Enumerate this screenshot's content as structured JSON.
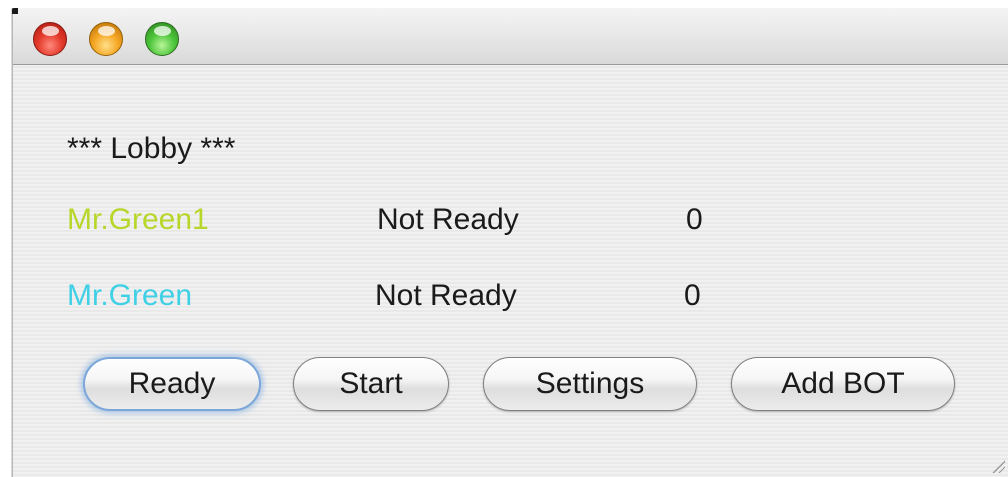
{
  "window": {
    "lobby_title": "*** Lobby ***"
  },
  "players": [
    {
      "name": "Mr.Green1",
      "status": "Not Ready",
      "score": "0",
      "color": "#b7d62a"
    },
    {
      "name": "Mr.Green",
      "status": "Not Ready",
      "score": "0",
      "color": "#3fd0e6"
    }
  ],
  "buttons": {
    "ready": "Ready",
    "start": "Start",
    "settings": "Settings",
    "add_bot": "Add BOT"
  },
  "icons": {
    "close": "close-icon",
    "minimize": "minimize-icon",
    "zoom": "zoom-icon"
  },
  "colors": {
    "default_button_glow": "#7aa6d8"
  }
}
